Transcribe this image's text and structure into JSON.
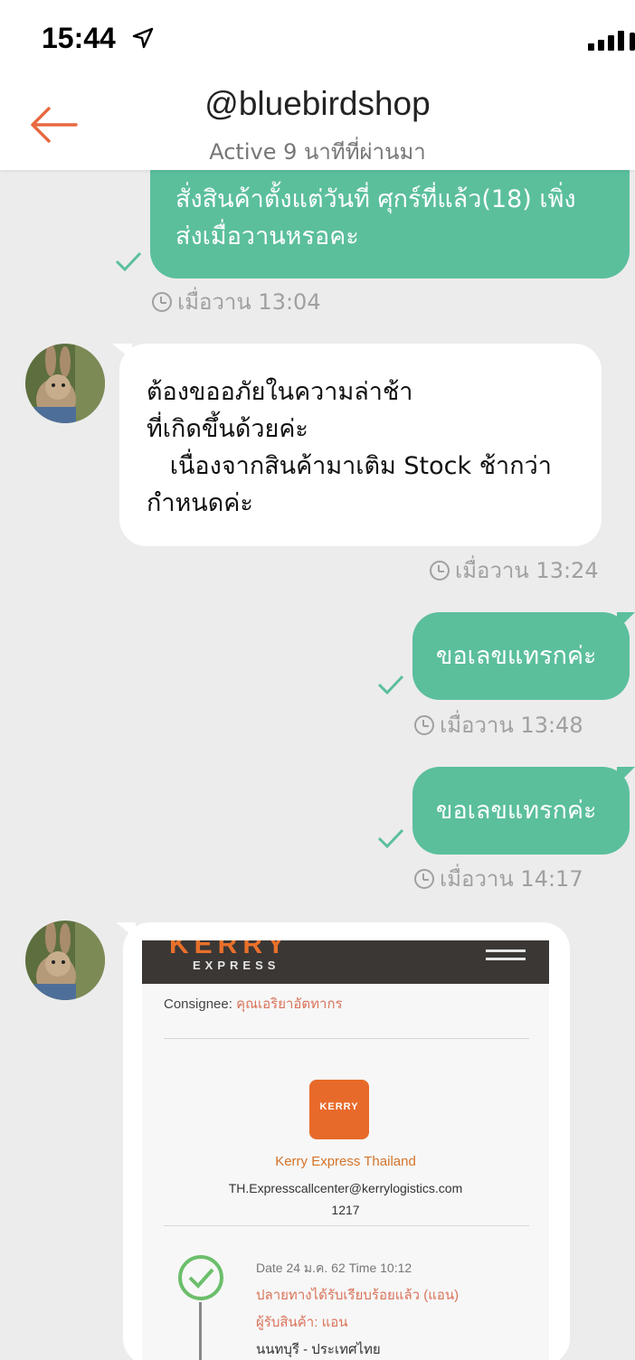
{
  "status_bar": {
    "time": "15:44"
  },
  "header": {
    "title": "@bluebirdshop",
    "subtitle": "Active 9 นาทีที่ผ่านมา"
  },
  "messages": [
    {
      "lines": [
        "สั่งสินค้าตั้งแต่วันที่ ศุกร์ที่แล้ว(18) เพิ่ง",
        "ส่งเมื่อวานหรอคะ"
      ],
      "time": "เมื่อวาน 13:04"
    },
    {
      "lines": [
        "ต้องขออภัยในความล่าช้า",
        "ที่เกิดขึ้นด้วยค่ะ",
        "   เนื่องจากสินค้ามาเติม Stock ช้ากว่า",
        "กำหนดค่ะ"
      ],
      "time": "เมื่อวาน 13:24"
    },
    {
      "lines": [
        "ขอเลขแทรกค่ะ"
      ],
      "time": "เมื่อวาน 13:48"
    },
    {
      "lines": [
        "ขอเลขแทรกค่ะ"
      ],
      "time": "เมื่อวาน 14:17"
    }
  ],
  "shared_screenshot": {
    "brand": "KERRY",
    "brand_sub": "EXPRESS",
    "consignee_label": "Consignee:",
    "consignee_value": "คุณเอริยาอัตทากร",
    "logo_text": "KERRY",
    "company": "Kerry Express Thailand",
    "email": "TH.Expresscallcenter@kerrylogistics.com",
    "phone": "1217",
    "date_line": "Date 24 ม.ค. 62 Time 10:12",
    "status_line": "ปลายทางได้รับเรียบร้อยแล้ว (แอน)",
    "receiver_line": "ผู้รับสินค้า: แอน",
    "location_line": "นนทบุรี - ประเทศไทย"
  },
  "colors": {
    "outgoing_bubble": "#5bbf9c",
    "incoming_bubble": "#ffffff",
    "accent": "#e8683f",
    "background": "#ececec"
  }
}
